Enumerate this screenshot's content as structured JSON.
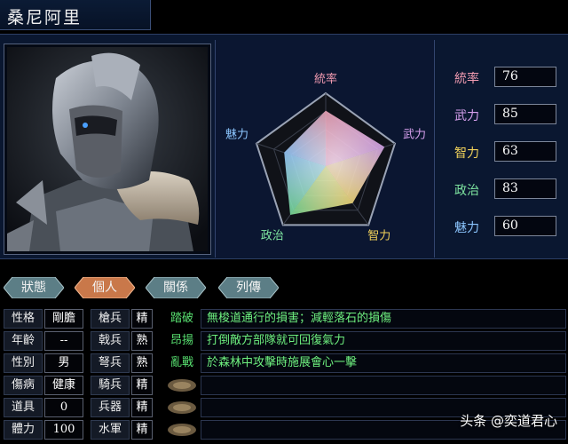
{
  "officer_name": "桑尼阿里",
  "radar": {
    "labels": [
      "統率",
      "武力",
      "智力",
      "政治",
      "魅力"
    ],
    "values": [
      76,
      85,
      63,
      83,
      60
    ],
    "max": 100
  },
  "stats": [
    {
      "label": "統率",
      "value": "76",
      "color": "#f09ab0"
    },
    {
      "label": "武力",
      "value": "85",
      "color": "#d7a0ee"
    },
    {
      "label": "智力",
      "value": "63",
      "color": "#f2d25a"
    },
    {
      "label": "政治",
      "value": "83",
      "color": "#7ee5a0"
    },
    {
      "label": "魅力",
      "value": "60",
      "color": "#8cc6ff"
    }
  ],
  "tabs": [
    {
      "label": "狀態",
      "active": false
    },
    {
      "label": "個人",
      "active": true
    },
    {
      "label": "關係",
      "active": false
    },
    {
      "label": "列傳",
      "active": false
    }
  ],
  "personal": [
    {
      "label": "性格",
      "value": "剛膽"
    },
    {
      "label": "年齡",
      "value": "--"
    },
    {
      "label": "性別",
      "value": "男"
    },
    {
      "label": "傷病",
      "value": "健康"
    },
    {
      "label": "道具",
      "value": "0"
    },
    {
      "label": "體力",
      "value": "100"
    }
  ],
  "troops": [
    {
      "label": "槍兵",
      "value": "精"
    },
    {
      "label": "戟兵",
      "value": "熟"
    },
    {
      "label": "弩兵",
      "value": "熟"
    },
    {
      "label": "騎兵",
      "value": "精"
    },
    {
      "label": "兵器",
      "value": "精"
    },
    {
      "label": "水軍",
      "value": "精"
    }
  ],
  "skills": [
    {
      "name": "踏破",
      "desc": "無梭道通行的損害；減輕落石的損傷"
    },
    {
      "name": "昂揚",
      "desc": "打倒敵方部隊就可回復氣力"
    },
    {
      "name": "亂戰",
      "desc": "於森林中攻擊時施展會心一擊"
    },
    {
      "name": "",
      "desc": ""
    },
    {
      "name": "",
      "desc": ""
    },
    {
      "name": "",
      "desc": ""
    }
  ],
  "watermark": "头条 @奕道君心",
  "colors": {
    "panel_bg": "#0a1730",
    "tab_active": "#c9784a",
    "tab_inactive": "#5c7e86",
    "skill_text": "#6ef07f"
  }
}
